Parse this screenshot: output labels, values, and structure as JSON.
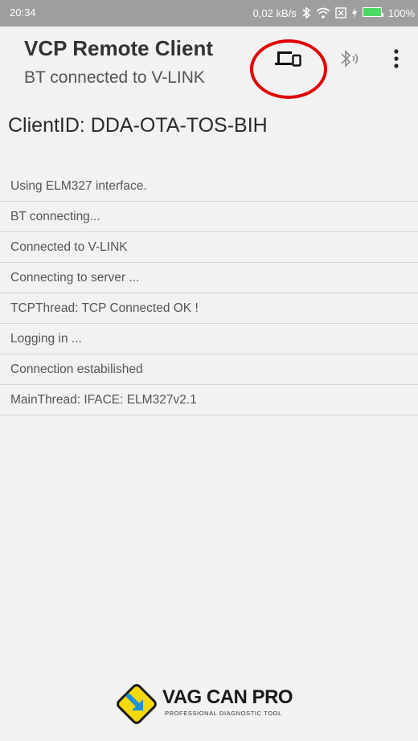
{
  "status_bar": {
    "time": "20:34",
    "speed": "0,02 kB/s",
    "battery": "100%",
    "icons": [
      "bluetooth-icon",
      "wifi-icon",
      "sim-icon",
      "charging-icon",
      "battery-icon"
    ]
  },
  "app_bar": {
    "title": "VCP Remote Client",
    "subtitle": "BT connected to V-LINK",
    "actions": [
      "devices-icon",
      "bluetooth-audio-icon",
      "more-vert-icon"
    ],
    "highlight_color": "#e00000"
  },
  "client": {
    "id_label": "ClientID: DDA-OTA-TOS-BIH"
  },
  "log": [
    "Using ELM327 interface.",
    "BT connecting...",
    "Connected to V-LINK",
    "Connecting to server ...",
    "TCPThread: TCP Connected OK !",
    "Logging in ...",
    "Connection estabilished",
    "MainThread: IFACE: ELM327v2.1"
  ],
  "logo": {
    "name": "VAG CAN PRO",
    "tagline": "PROFESSIONAL DIAGNOSTIC TOOL",
    "colors": {
      "diamond": "#f5d90a",
      "arrow": "#1e90e0",
      "outline": "#1a1a1a"
    }
  },
  "colors": {
    "status_bar_bg": "#9e9e9e",
    "background": "#f2f2f2",
    "divider": "#d4d4d4"
  }
}
